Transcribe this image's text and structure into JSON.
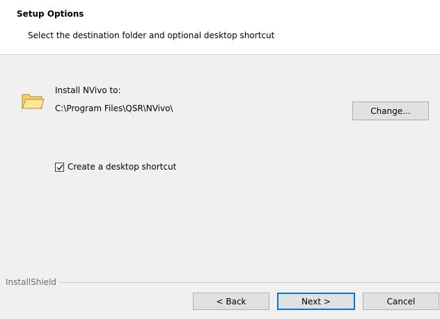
{
  "header": {
    "title": "Setup Options",
    "subtitle": "Select the destination folder and optional desktop shortcut"
  },
  "install": {
    "label": "Install NVivo to:",
    "path": "C:\\Program Files\\QSR\\NVivo\\",
    "change_label": "Change...",
    "icon": "folder-icon"
  },
  "shortcut": {
    "label": "Create a desktop shortcut",
    "checked": true
  },
  "footer": {
    "brand": "InstallShield",
    "back_label": "< Back",
    "next_label": "Next >",
    "cancel_label": "Cancel"
  },
  "colors": {
    "accent": "#0078d7",
    "folder": "#f6d77a"
  }
}
